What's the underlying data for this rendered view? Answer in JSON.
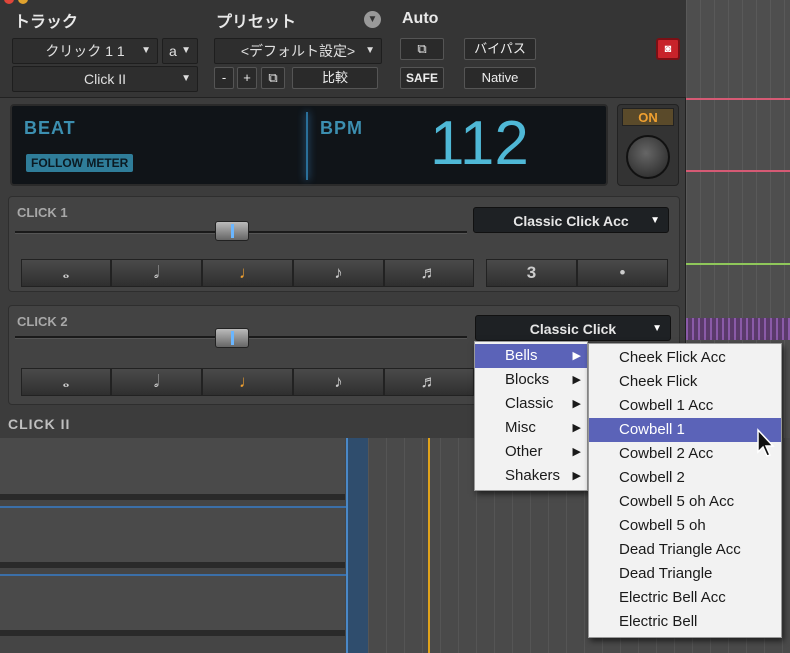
{
  "header": {
    "track_label": "トラック",
    "preset_label": "プリセット",
    "auto_label": "Auto"
  },
  "track": {
    "name": "クリック 1 1",
    "channel": "a",
    "plugin": "Click II"
  },
  "preset": {
    "current": "<デフォルト設定>",
    "minus": "-",
    "plus": "+",
    "compare": "比較"
  },
  "auto": {
    "safe": "SAFE"
  },
  "right": {
    "bypass": "バイパス",
    "native": "Native"
  },
  "display": {
    "beat_label": "BEAT",
    "follow_meter": "FOLLOW METER",
    "bpm_label": "BPM",
    "bpm_value": "112",
    "on": "ON"
  },
  "click1": {
    "label": "CLICK 1",
    "sound": "Classic Click Acc",
    "level": 0.36,
    "count": "3"
  },
  "click2": {
    "label": "CLICK 2",
    "sound": "Classic Click",
    "level": 0.36
  },
  "footer": {
    "plugin_name": "CLICK II"
  },
  "menu": {
    "categories": [
      {
        "label": "Bells"
      },
      {
        "label": "Blocks"
      },
      {
        "label": "Classic"
      },
      {
        "label": "Misc"
      },
      {
        "label": "Other"
      },
      {
        "label": "Shakers"
      }
    ],
    "selected_category": "Bells",
    "items": [
      {
        "label": "Cheek Flick Acc"
      },
      {
        "label": "Cheek Flick"
      },
      {
        "label": "Cowbell 1 Acc"
      },
      {
        "label": "Cowbell 1"
      },
      {
        "label": "Cowbell 2 Acc"
      },
      {
        "label": "Cowbell 2"
      },
      {
        "label": "Cowbell 5 oh Acc"
      },
      {
        "label": "Cowbell 5 oh"
      },
      {
        "label": "Dead Triangle Acc"
      },
      {
        "label": "Dead Triangle"
      },
      {
        "label": "Electric Bell Acc"
      },
      {
        "label": "Electric Bell"
      }
    ],
    "selected_item": "Cowbell 1"
  },
  "colors": {
    "accent": "#3c8fb0",
    "bpm": "#4fb8d6",
    "menu_highlight": "#5b63b8",
    "playhead": "#e0a21a"
  }
}
